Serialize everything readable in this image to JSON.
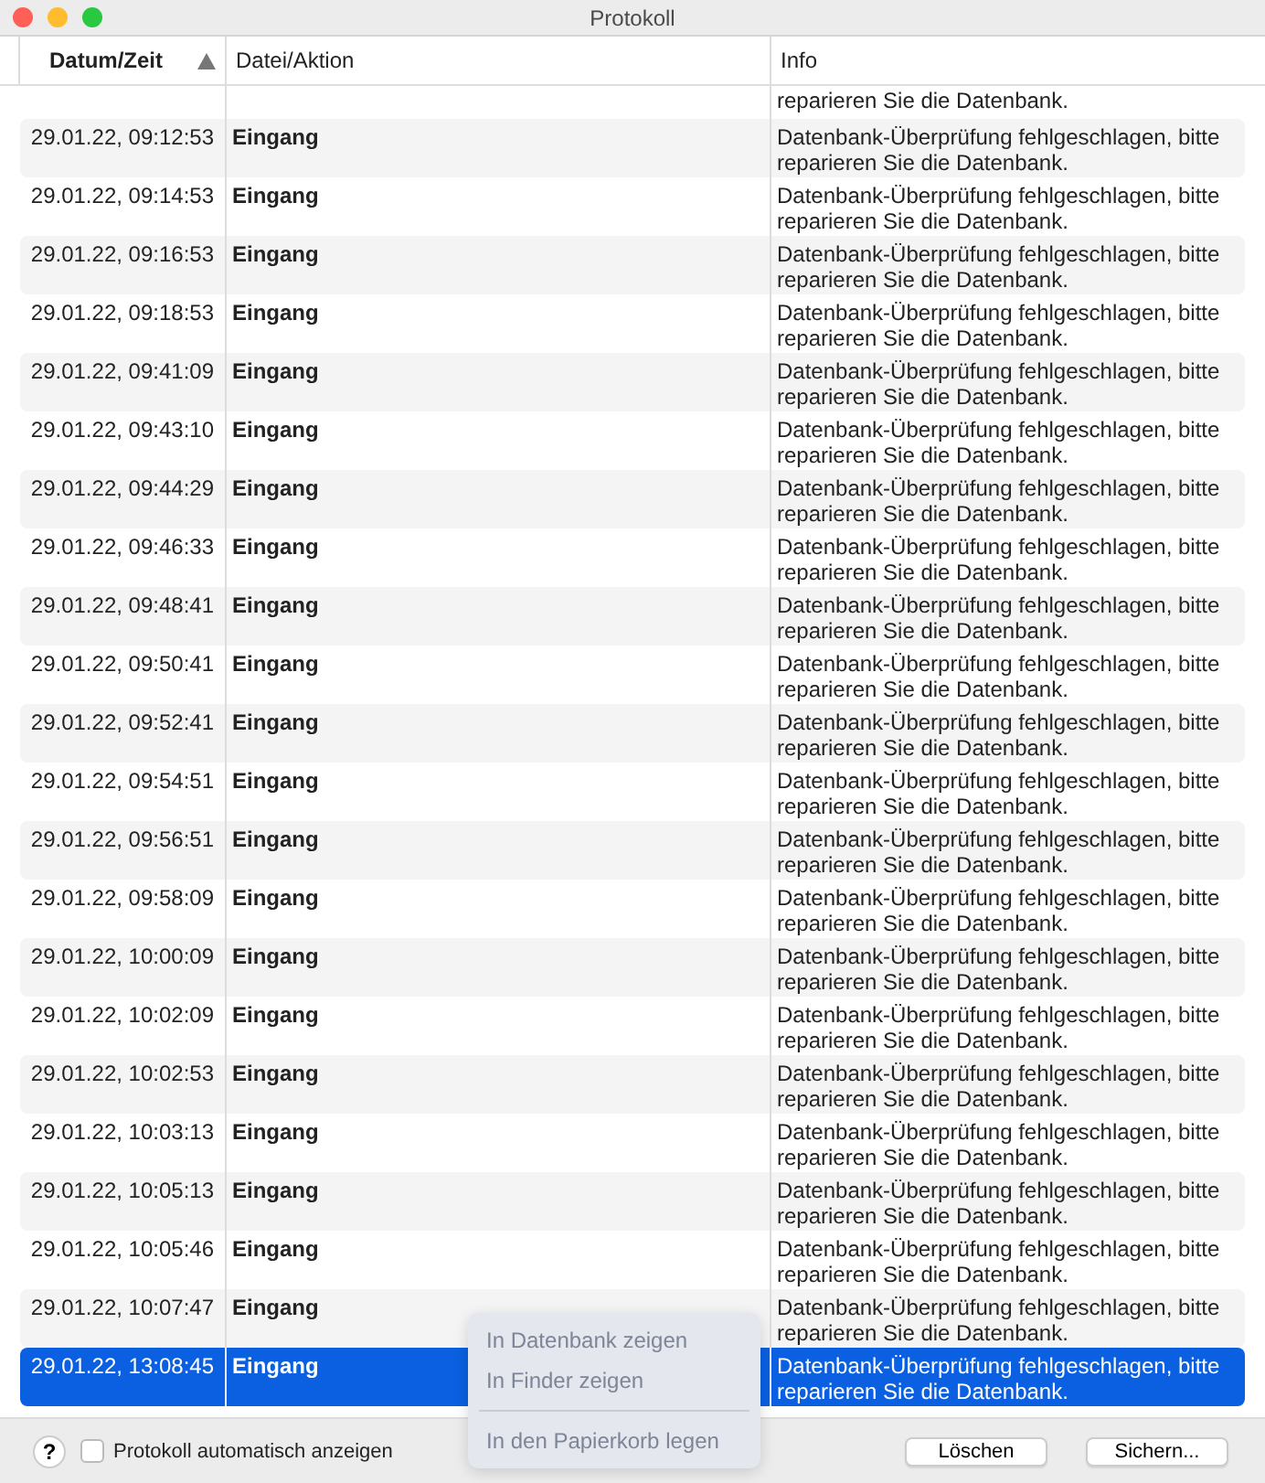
{
  "window": {
    "title": "Protokoll"
  },
  "table": {
    "columns": [
      {
        "label": "Datum/Zeit",
        "sorted": true
      },
      {
        "label": "Datei/Aktion",
        "sorted": false
      },
      {
        "label": "Info",
        "sorted": false
      }
    ],
    "partial_row": {
      "info": "reparieren Sie die Datenbank."
    },
    "rows": [
      {
        "time": "29.01.22, 09:12:53",
        "action": "Eingang",
        "info": "Datenbank-Überprüfung fehlgeschlagen, bitte reparieren Sie die Datenbank.",
        "selected": false
      },
      {
        "time": "29.01.22, 09:14:53",
        "action": "Eingang",
        "info": "Datenbank-Überprüfung fehlgeschlagen, bitte reparieren Sie die Datenbank.",
        "selected": false
      },
      {
        "time": "29.01.22, 09:16:53",
        "action": "Eingang",
        "info": "Datenbank-Überprüfung fehlgeschlagen, bitte reparieren Sie die Datenbank.",
        "selected": false
      },
      {
        "time": "29.01.22, 09:18:53",
        "action": "Eingang",
        "info": "Datenbank-Überprüfung fehlgeschlagen, bitte reparieren Sie die Datenbank.",
        "selected": false
      },
      {
        "time": "29.01.22, 09:41:09",
        "action": "Eingang",
        "info": "Datenbank-Überprüfung fehlgeschlagen, bitte reparieren Sie die Datenbank.",
        "selected": false
      },
      {
        "time": "29.01.22, 09:43:10",
        "action": "Eingang",
        "info": "Datenbank-Überprüfung fehlgeschlagen, bitte reparieren Sie die Datenbank.",
        "selected": false
      },
      {
        "time": "29.01.22, 09:44:29",
        "action": "Eingang",
        "info": "Datenbank-Überprüfung fehlgeschlagen, bitte reparieren Sie die Datenbank.",
        "selected": false
      },
      {
        "time": "29.01.22, 09:46:33",
        "action": "Eingang",
        "info": "Datenbank-Überprüfung fehlgeschlagen, bitte reparieren Sie die Datenbank.",
        "selected": false
      },
      {
        "time": "29.01.22, 09:48:41",
        "action": "Eingang",
        "info": "Datenbank-Überprüfung fehlgeschlagen, bitte reparieren Sie die Datenbank.",
        "selected": false
      },
      {
        "time": "29.01.22, 09:50:41",
        "action": "Eingang",
        "info": "Datenbank-Überprüfung fehlgeschlagen, bitte reparieren Sie die Datenbank.",
        "selected": false
      },
      {
        "time": "29.01.22, 09:52:41",
        "action": "Eingang",
        "info": "Datenbank-Überprüfung fehlgeschlagen, bitte reparieren Sie die Datenbank.",
        "selected": false
      },
      {
        "time": "29.01.22, 09:54:51",
        "action": "Eingang",
        "info": "Datenbank-Überprüfung fehlgeschlagen, bitte reparieren Sie die Datenbank.",
        "selected": false
      },
      {
        "time": "29.01.22, 09:56:51",
        "action": "Eingang",
        "info": "Datenbank-Überprüfung fehlgeschlagen, bitte reparieren Sie die Datenbank.",
        "selected": false
      },
      {
        "time": "29.01.22, 09:58:09",
        "action": "Eingang",
        "info": "Datenbank-Überprüfung fehlgeschlagen, bitte reparieren Sie die Datenbank.",
        "selected": false
      },
      {
        "time": "29.01.22, 10:00:09",
        "action": "Eingang",
        "info": "Datenbank-Überprüfung fehlgeschlagen, bitte reparieren Sie die Datenbank.",
        "selected": false
      },
      {
        "time": "29.01.22, 10:02:09",
        "action": "Eingang",
        "info": "Datenbank-Überprüfung fehlgeschlagen, bitte reparieren Sie die Datenbank.",
        "selected": false
      },
      {
        "time": "29.01.22, 10:02:53",
        "action": "Eingang",
        "info": "Datenbank-Überprüfung fehlgeschlagen, bitte reparieren Sie die Datenbank.",
        "selected": false
      },
      {
        "time": "29.01.22, 10:03:13",
        "action": "Eingang",
        "info": "Datenbank-Überprüfung fehlgeschlagen, bitte reparieren Sie die Datenbank.",
        "selected": false
      },
      {
        "time": "29.01.22, 10:05:13",
        "action": "Eingang",
        "info": "Datenbank-Überprüfung fehlgeschlagen, bitte reparieren Sie die Datenbank.",
        "selected": false
      },
      {
        "time": "29.01.22, 10:05:46",
        "action": "Eingang",
        "info": "Datenbank-Überprüfung fehlgeschlagen, bitte reparieren Sie die Datenbank.",
        "selected": false
      },
      {
        "time": "29.01.22, 10:07:47",
        "action": "Eingang",
        "info": "Datenbank-Überprüfung fehlgeschlagen, bitte reparieren Sie die Datenbank.",
        "selected": false
      },
      {
        "time": "29.01.22, 13:08:45",
        "action": "Eingang",
        "info": "Datenbank-Überprüfung fehlgeschlagen, bitte reparieren Sie die Datenbank.",
        "selected": true
      }
    ]
  },
  "context_menu": {
    "items": [
      {
        "kind": "item",
        "label": "In Datenbank zeigen",
        "disabled": true
      },
      {
        "kind": "item",
        "label": "In Finder zeigen",
        "disabled": true
      },
      {
        "kind": "separator"
      },
      {
        "kind": "item",
        "label": "In den Papierkorb legen",
        "disabled": true
      }
    ]
  },
  "footer": {
    "help": "?",
    "checkbox": {
      "label": "Protokoll automatisch anzeigen",
      "checked": false
    },
    "buttons": [
      "Löschen",
      "Sichern..."
    ]
  }
}
